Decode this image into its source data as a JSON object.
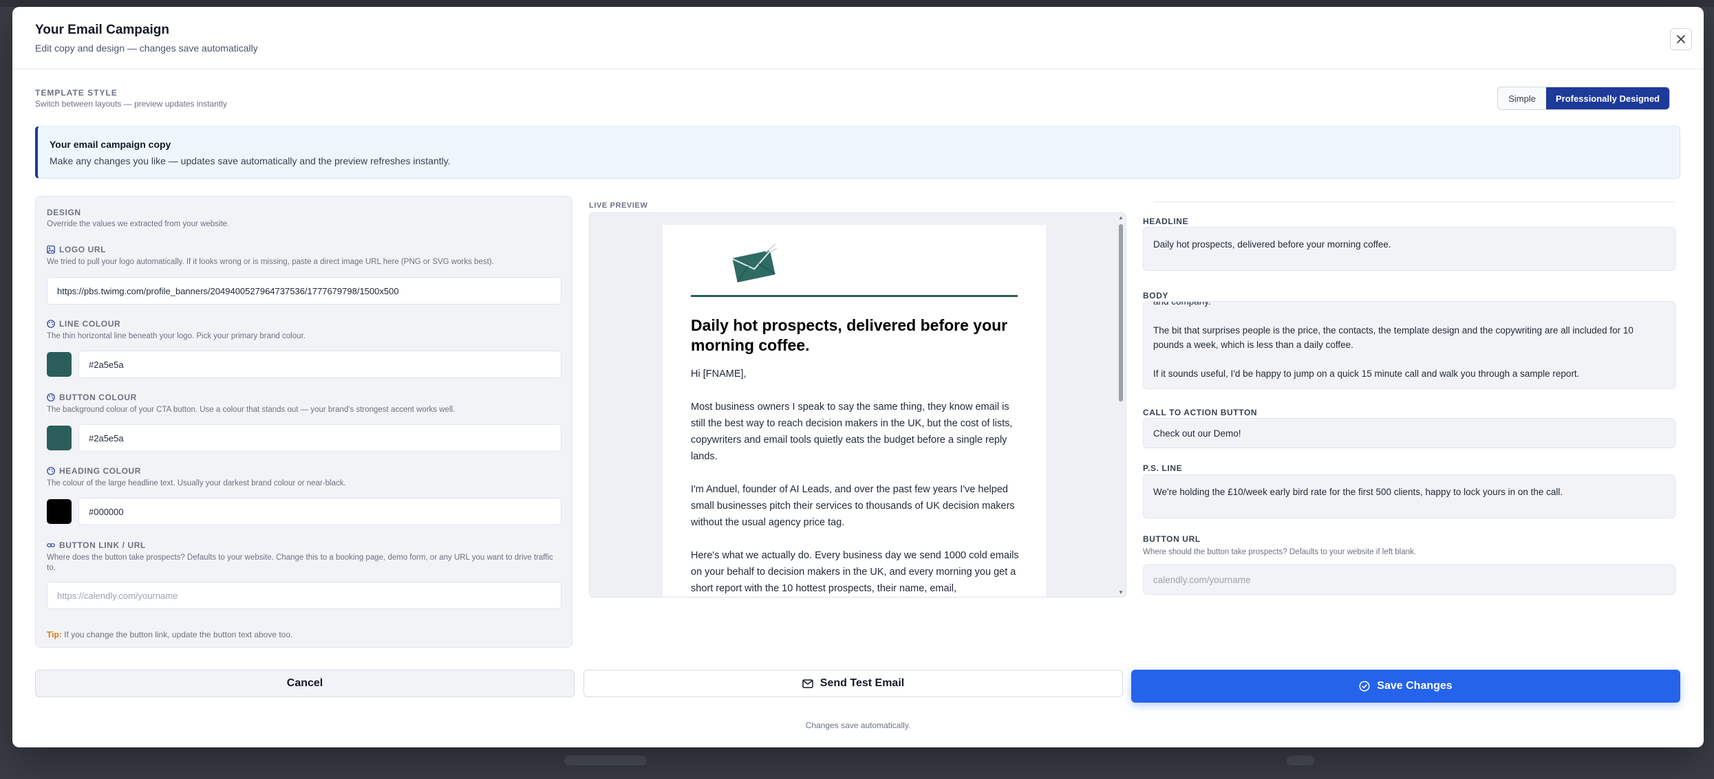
{
  "modal": {
    "title": "Your Email Campaign",
    "subtitle": "Edit copy and design — changes save automatically",
    "close_icon": "close-icon"
  },
  "template_style": {
    "label": "TEMPLATE STYLE",
    "help": "Switch between layouts — preview updates instantly",
    "options": [
      "Simple",
      "Professionally Designed"
    ],
    "selected": "Professionally Designed"
  },
  "info": {
    "title": "Your email campaign copy",
    "text": "Make any changes you like — updates save automatically and the preview refreshes instantly."
  },
  "design": {
    "title": "DESIGN",
    "help": "Override the values we extracted from your website.",
    "logo": {
      "label": "LOGO URL",
      "help": "We tried to pull your logo automatically. If it looks wrong or is missing, paste a direct image URL here (PNG or SVG works best).",
      "value": "https://pbs.twimg.com/profile_banners/2049400527964737536/1777679798/1500x500"
    },
    "line_colour": {
      "label": "LINE COLOUR",
      "help": "The thin horizontal line beneath your logo. Pick your primary brand colour.",
      "value": "#2a5e5a"
    },
    "button_colour": {
      "label": "BUTTON COLOUR",
      "help": "The background colour of your CTA button. Use a colour that stands out — your brand's strongest accent works well.",
      "value": "#2a5e5a"
    },
    "heading_colour": {
      "label": "HEADING COLOUR",
      "help": "The colour of the large headline text. Usually your darkest brand colour or near-black.",
      "value": "#000000"
    },
    "button_link": {
      "label": "BUTTON LINK / URL",
      "help": "Where does the button take prospects? Defaults to your website. Change this to a booking page, demo form, or any URL you want to drive traffic to.",
      "placeholder": "https://calendly.com/yourname"
    },
    "tip_label": "Tip:",
    "tip_text": " If you change the button link, update the button text above too."
  },
  "preview": {
    "label": "LIVE PREVIEW",
    "headline": "Daily hot prospects, delivered before your morning coffee.",
    "paragraphs": [
      "Hi [FNAME],",
      "Most business owners I speak to say the same thing, they know email is still the best way to reach decision makers in the UK, but the cost of lists, copywriters and email tools quietly eats the budget before a single reply lands.",
      "I'm Anduel, founder of AI Leads, and over the past few years I've helped small businesses pitch their services to thousands of UK decision makers without the usual agency price tag.",
      "Here's what we actually do. Every business day we send 1000 cold emails on your behalf to decision makers in the UK, and every morning you get a short report with the 10 hottest prospects, their name, email,"
    ]
  },
  "fields": {
    "headline": {
      "label": "HEADLINE",
      "value": "Daily hot prospects, delivered before your morning coffee."
    },
    "body": {
      "label": "BODY",
      "value_top": "and company.",
      "value_p1": "The bit that surprises people is the price, the contacts, the template design and the copywriting are all included for 10 pounds a week, which is less than a daily coffee.",
      "value_p2": "If it sounds useful, I'd be happy to jump on a quick 15 minute call and walk you through a sample report."
    },
    "cta": {
      "label": "CALL TO ACTION BUTTON",
      "value": "Check out our Demo!"
    },
    "ps": {
      "label": "P.S. LINE",
      "value": "We're holding the £10/week early bird rate for the first 500 clients, happy to lock yours in on the call."
    },
    "button_url": {
      "label": "BUTTON URL",
      "help": "Where should the button take prospects? Defaults to your website if left blank.",
      "placeholder": "calendly.com/yourname"
    }
  },
  "footer": {
    "cancel": "Cancel",
    "send_test": "Send Test Email",
    "save": "Save Changes",
    "note": "Changes save automatically."
  },
  "colors": {
    "accent": "#1e3a9a",
    "primary_button": "#2563eb",
    "brand_line": "#2a5e5a",
    "heading": "#000000"
  }
}
